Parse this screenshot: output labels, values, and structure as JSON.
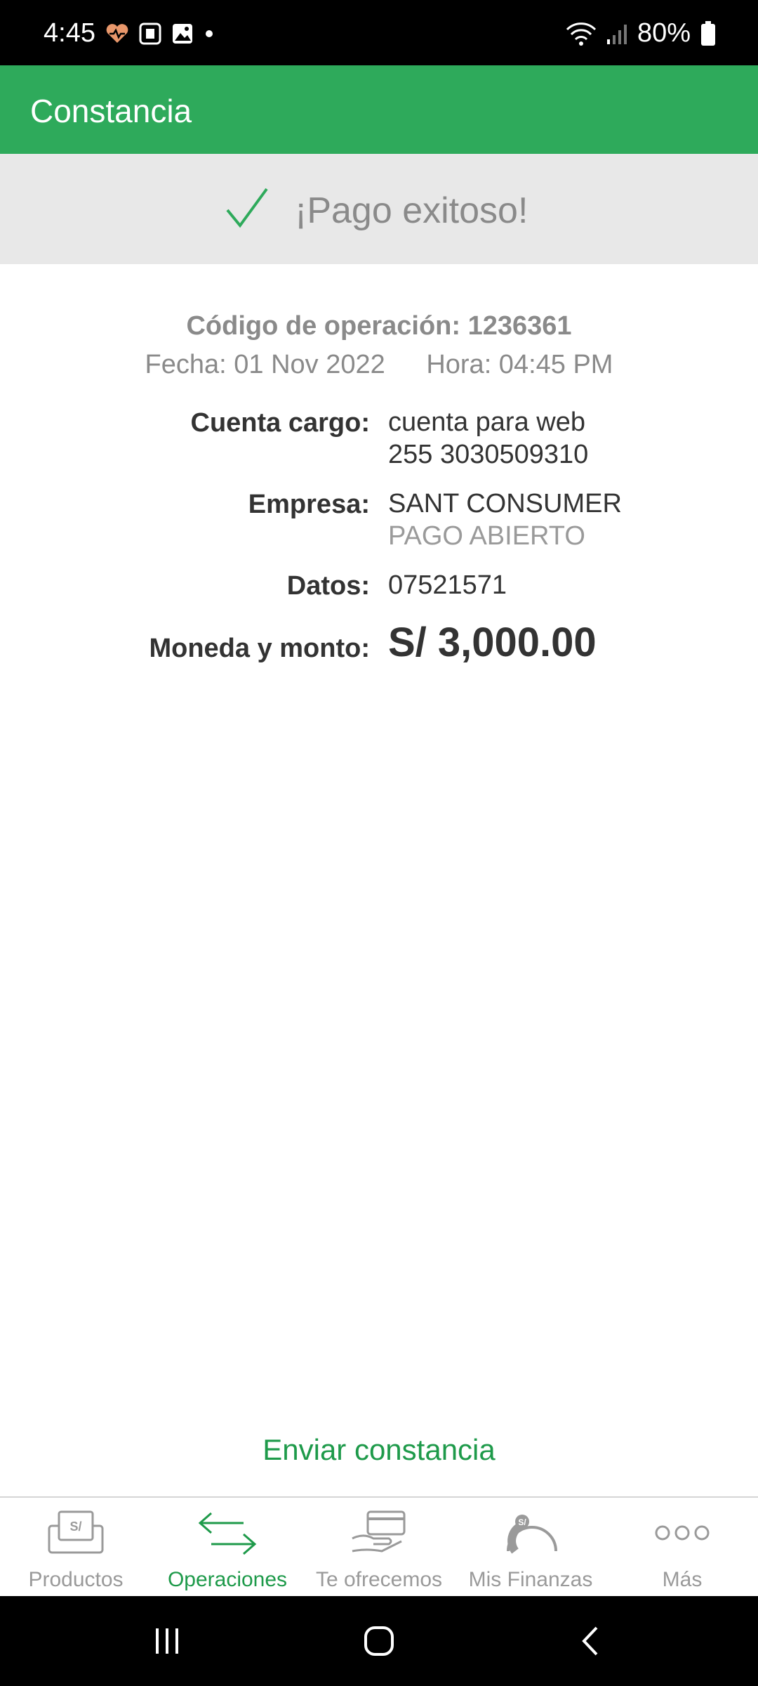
{
  "status_bar": {
    "time": "4:45",
    "battery": "80%"
  },
  "app_bar": {
    "title": "Constancia"
  },
  "banner": {
    "message": "¡Pago exitoso!"
  },
  "receipt": {
    "operation_code": "Código de operación: 1236361",
    "date": "Fecha: 01 Nov 2022",
    "time": "Hora: 04:45 PM",
    "rows": [
      {
        "label": "Cuenta cargo:",
        "value": "cuenta para web",
        "value2": "255 3030509310"
      },
      {
        "label": "Empresa:",
        "value": "SANT CONSUMER",
        "value2": "PAGO ABIERTO"
      },
      {
        "label": "Datos:",
        "value": "07521571"
      },
      {
        "label": "Moneda y monto:",
        "value": "S/ 3,000.00"
      }
    ]
  },
  "actions": {
    "send_receipt": "Enviar constancia"
  },
  "bottom_nav": {
    "items": [
      {
        "label": "Productos",
        "icon": "products-icon"
      },
      {
        "label": "Operaciones",
        "icon": "operations-icon",
        "active": true
      },
      {
        "label": "Te ofrecemos",
        "icon": "offers-icon"
      },
      {
        "label": "Mis Finanzas",
        "icon": "finances-icon"
      },
      {
        "label": "Más",
        "icon": "more-icon"
      }
    ],
    "colors": {
      "active": "#1e9a4a",
      "inactive": "#9a9a9a"
    }
  },
  "theme": {
    "primary": "#2eaa5b"
  }
}
